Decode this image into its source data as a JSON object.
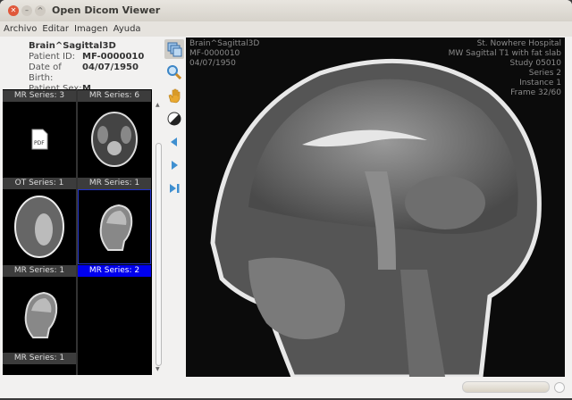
{
  "window": {
    "title": "Open Dicom Viewer"
  },
  "menu": [
    "Archivo",
    "Editar",
    "Imagen",
    "Ayuda"
  ],
  "patient": {
    "name": "Brain^Sagittal3D",
    "id_label": "Patient ID:",
    "id": "MF-0000010",
    "dob_label": "Date of Birth:",
    "dob": "04/07/1950",
    "sex_label": "Patient Sex:",
    "sex": "M"
  },
  "thumbnails": [
    {
      "label": "MR Series: 3",
      "kind": "none"
    },
    {
      "label": "MR Series: 6",
      "kind": "none"
    },
    {
      "label": "OT Series: 1",
      "kind": "pdf"
    },
    {
      "label": "MR Series: 1",
      "kind": "axial"
    },
    {
      "label": "MR Series: 1",
      "kind": "axial2"
    },
    {
      "label": "MR Series: 2",
      "kind": "sag",
      "selected": true
    },
    {
      "label": "MR Series: 1",
      "kind": "sag"
    }
  ],
  "pdf_icon_text": "PDF",
  "tools": [
    "layout-icon",
    "zoom-icon",
    "pan-hand-icon",
    "window-level-icon",
    "previous-icon",
    "next-icon",
    "last-icon"
  ],
  "overlay": {
    "left": [
      "Brain^Sagittal3D",
      "MF-0000010",
      "04/07/1950"
    ],
    "right": [
      "St. Nowhere Hospital",
      "MW Sagittal T1 with fat slab",
      "Study 05010",
      "Series 2",
      "Instance 1",
      "Frame 32/60"
    ]
  },
  "colors": {
    "selected": "#0000ee"
  }
}
